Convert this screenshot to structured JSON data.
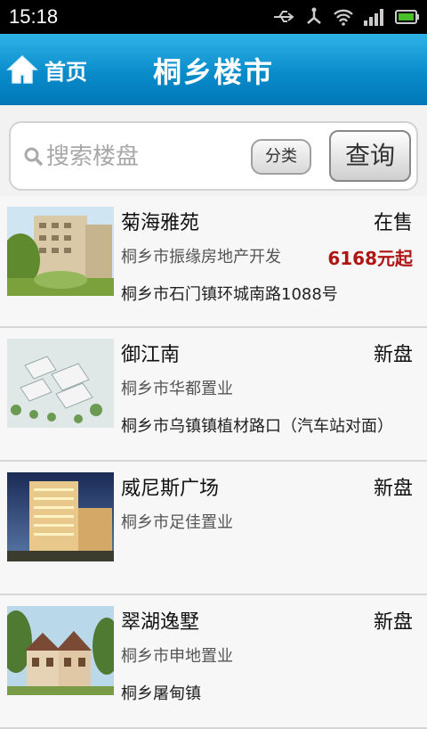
{
  "status_bar": {
    "time": "15:18"
  },
  "header": {
    "home_label": "首页",
    "title": "桐乡楼市"
  },
  "search": {
    "placeholder": "搜索楼盘",
    "category_label": "分类",
    "query_label": "查询"
  },
  "listings": [
    {
      "name": "菊海雅苑",
      "status": "在售",
      "developer": "桐乡市振缘房地产开发",
      "price": "6168元起",
      "address": "桐乡市石门镇环城南路1088号"
    },
    {
      "name": "御江南",
      "status": "新盘",
      "developer": "桐乡市华都置业",
      "price": "",
      "address": "桐乡市乌镇镇植材路口（汽车站对面）"
    },
    {
      "name": "威尼斯广场",
      "status": "新盘",
      "developer": "桐乡市足佳置业",
      "price": "",
      "address": ""
    },
    {
      "name": "翠湖逸墅",
      "status": "新盘",
      "developer": "桐乡市申地置业",
      "price": "",
      "address": "桐乡屠甸镇"
    }
  ],
  "colors": {
    "header_blue": "#0a8ccb",
    "price_red": "#b01515"
  }
}
